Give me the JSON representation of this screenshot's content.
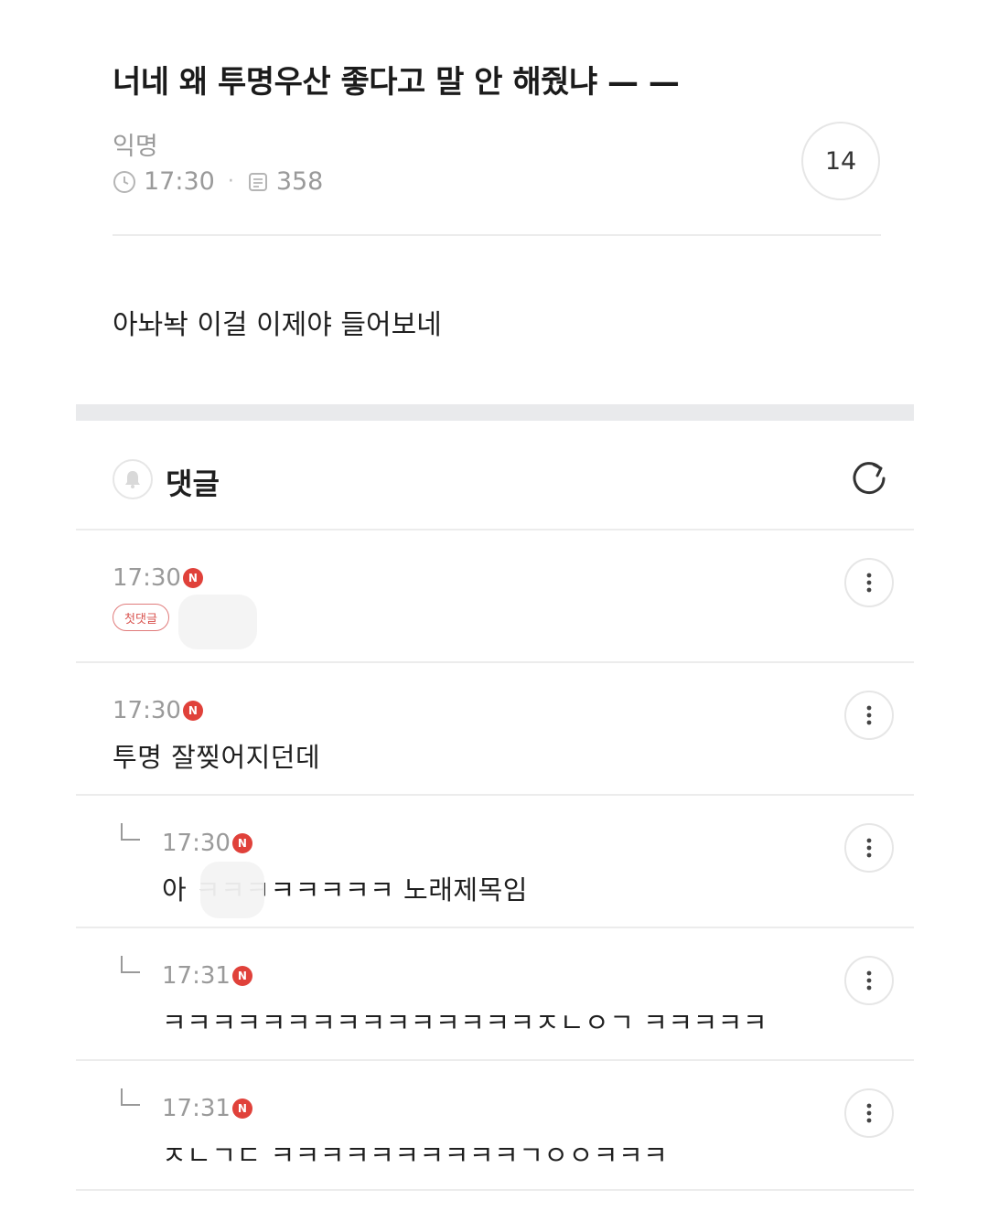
{
  "post": {
    "title": "너네 왜 투명우산 좋다고 말 안 해줬냐 — —",
    "author": "익명",
    "time": "17:30",
    "views": "358",
    "comment_count": "14",
    "body": "아놔놕 이걸 이제야 들어보네"
  },
  "comments_section": {
    "label": "댓글"
  },
  "comments": [
    {
      "time": "17:30",
      "badge": "첫댓글",
      "text": "",
      "new_badge": "N"
    },
    {
      "time": "17:30",
      "text": "투명 잘찢어지던데",
      "new_badge": "N"
    },
    {
      "time": "17:30",
      "text": "아 ㅋㅋㅋㅋㅋㅋㅋㅋ 노래제목임",
      "new_badge": "N",
      "reply": true
    },
    {
      "time": "17:31",
      "text": "ㅋㅋㅋㅋㅋㅋㅋㅋㅋㅋㅋㅋㅋㅋㅋㅈㄴㅇㄱ ㅋㅋㅋㅋㅋ",
      "new_badge": "N",
      "reply": true
    },
    {
      "time": "17:31",
      "text": "ㅈㄴㄱㄷ ㅋㅋㅋㅋㅋㅋㅋㅋㅋㅋㄱㅇㅇㅋㅋㅋ",
      "new_badge": "N",
      "reply": true
    }
  ],
  "colors": {
    "accent_red": "#e0413a",
    "muted_text": "#9a9a9a",
    "divider": "#ececec"
  },
  "icons": {
    "clock": "clock-icon",
    "views": "document-icon",
    "bell": "bell-icon",
    "refresh": "refresh-icon",
    "more": "more-vertical-icon",
    "reply": "reply-arrow-icon"
  }
}
